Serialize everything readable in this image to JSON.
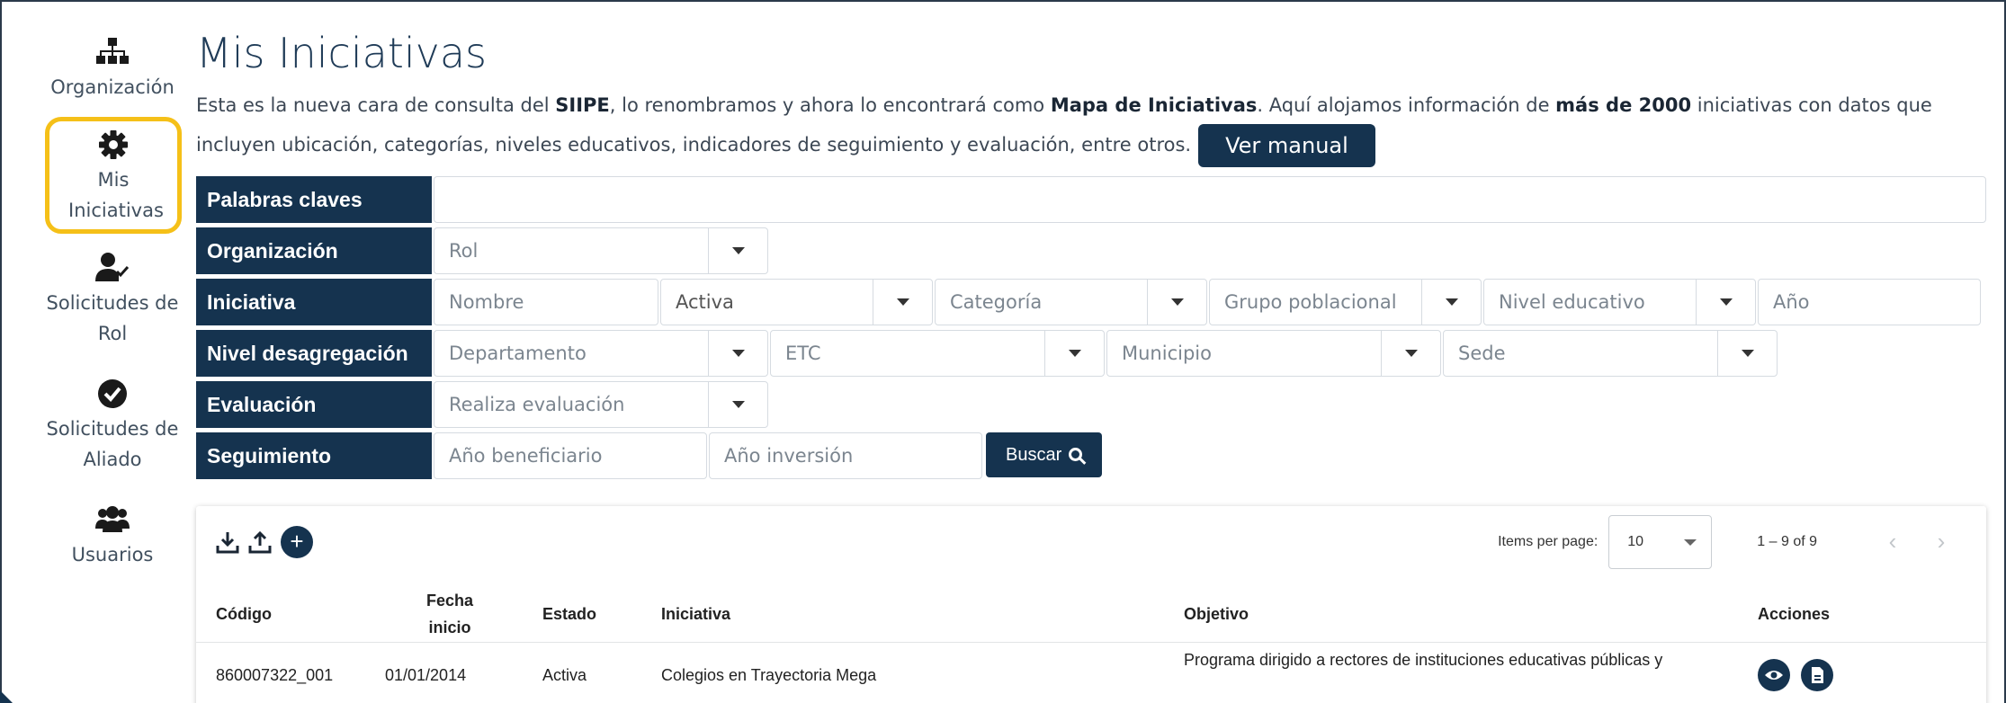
{
  "sidebar": {
    "items": [
      {
        "label": "Organización",
        "icon": "sitemap-icon"
      },
      {
        "label": "Mis Iniciativas",
        "icon": "gear-icon",
        "active": true
      },
      {
        "label": "Solicitudes de Rol",
        "icon": "user-check-icon"
      },
      {
        "label": "Solicitudes de Aliado",
        "icon": "check-circle-icon"
      },
      {
        "label": "Usuarios",
        "icon": "users-icon"
      }
    ]
  },
  "header": {
    "title": "Mis Iniciativas",
    "intro_1": "Esta es la nueva cara de consulta del ",
    "intro_b1": "SIIPE",
    "intro_2": ", lo renombramos y ahora lo encontrará como ",
    "intro_b2": "Mapa de Iniciativas",
    "intro_3": ". Aquí alojamos información de ",
    "intro_b3": "más de 2000",
    "intro_4": " iniciativas con datos que incluyen ubicación, categorías, niveles educativos, indicadores de seguimiento y evaluación, entre otros.",
    "manual_button": "Ver manual"
  },
  "filters": {
    "keywords_label": "Palabras claves",
    "keywords_value": "",
    "org_label": "Organización",
    "rol_placeholder": "Rol",
    "iniciativa_label": "Iniciativa",
    "nombre_placeholder": "Nombre",
    "estado_value": "Activa",
    "categoria_placeholder": "Categoría",
    "grupo_placeholder": "Grupo poblacional",
    "nivel_placeholder": "Nivel educativo",
    "anio_placeholder": "Año",
    "desag_label": "Nivel desagregación",
    "depto_placeholder": "Departamento",
    "etc_placeholder": "ETC",
    "municipio_placeholder": "Municipio",
    "sede_placeholder": "Sede",
    "eval_label": "Evaluación",
    "eval_placeholder": "Realiza evaluación",
    "seg_label": "Seguimiento",
    "anio_benef_placeholder": "Año beneficiario",
    "anio_inv_placeholder": "Año inversión",
    "buscar_button": "Buscar"
  },
  "table": {
    "items_per_page_label": "Items per page:",
    "items_per_page_value": "10",
    "range_label": "1 – 9 of 9",
    "columns": [
      "Código",
      "Fecha inicio",
      "Estado",
      "Iniciativa",
      "Objetivo",
      "Acciones"
    ],
    "rows": [
      {
        "codigo": "860007322_001",
        "fecha": "01/01/2014",
        "estado": "Activa",
        "iniciativa": "Colegios en Trayectoria Mega",
        "objetivo": "Programa dirigido a rectores de instituciones educativas públicas y"
      }
    ]
  },
  "colors": {
    "primary": "#15334f",
    "highlight": "#f5c018"
  }
}
